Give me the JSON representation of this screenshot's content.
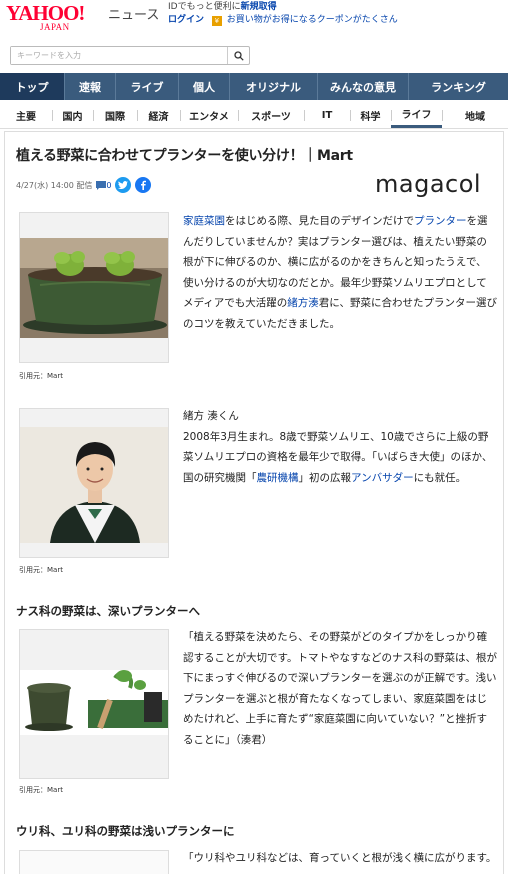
{
  "header": {
    "logo_main": "YAHOO!",
    "logo_sub": "JAPAN",
    "news_label": "ニュース",
    "promo_prefix": "IDでもっと便利に",
    "promo_link": "新規取得",
    "login_label": "ログイン",
    "coupon_text": "お買い物がお得になるクーポンがたくさん"
  },
  "search": {
    "placeholder": "キーワードを入力"
  },
  "nav": {
    "items": [
      "トップ",
      "速報",
      "ライブ",
      "個人",
      "オリジナル",
      "みんなの意見",
      "ランキング"
    ],
    "active": "トップ"
  },
  "subnav": {
    "items": [
      "主要",
      "国内",
      "国際",
      "経済",
      "エンタメ",
      "スポーツ",
      "IT",
      "科学",
      "ライフ",
      "地域"
    ],
    "active": "ライフ"
  },
  "article": {
    "title": "植える野菜に合わせてプランターを使い分け！｜Mart",
    "date": "4/27(水) 14:00",
    "delivered": "配信",
    "comment_count": "0",
    "brand": "magacol",
    "credit": "引用元：Mart",
    "p1": {
      "link1": "家庭菜園",
      "t1": "をはじめる際、見た目のデザインだけで",
      "link2": "プランター",
      "t2": "を選んだりしていませんか？実はプランター選びは、植えたい野菜の根が下に伸びるのか、横に広がるのかをきちんと知ったうえで、使い分けるのが大切なのだとか。最年少野菜ソムリエプロとしてメディアでも大活躍の",
      "link3": "緒方湊",
      "t3": "君に、野菜に合わせたプランター選びのコツを教えていただきました。"
    },
    "profile": {
      "name": "緒方 湊くん",
      "t1": "2008年3月生まれ。8歳で野菜ソムリエ、10歳でさらに上級の野菜ソムリエプロの資格を最年少で取得。「いばらき大使」のほか、国の研究機関「",
      "link1": "農研機構",
      "t2": "」初の広報",
      "link2": "アンバサダー",
      "t3": "にも就任。"
    },
    "section1": {
      "heading": "ナス科の野菜は、深いプランターへ",
      "text": "「植える野菜を決めたら、その野菜がどのタイプかをしっかり確認することが大切です。トマトやなすなどのナス科の野菜は、根が下にまっすぐ伸びるので深いプランターを選ぶのが正解です。浅いプランターを選ぶと根が育たなくなってしまい、家庭菜園をはじめたけれど、上手に育たず“家庭菜園に向いていない？”と挫折することに」（湊君）"
    },
    "section2": {
      "heading": "ウリ科、ユリ科の野菜は浅いプランターに",
      "text": "「ウリ科やユリ科などは、育っていくと根が浅く横に広がります。"
    }
  },
  "colors": {
    "yahoo_red": "#ff0033",
    "nav_bg": "#3a5b7d",
    "link": "#0645ad",
    "twitter": "#1d9bf0",
    "facebook": "#1877f2"
  }
}
